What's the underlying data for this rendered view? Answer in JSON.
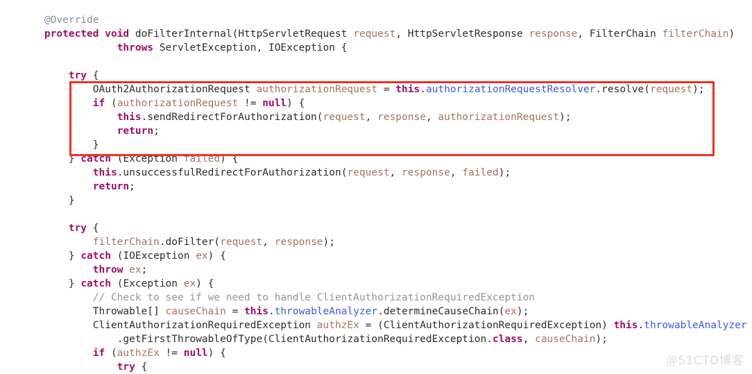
{
  "editor": {
    "language": "java",
    "background_color": "#ffffff",
    "colors": {
      "annotation": "#808fa0",
      "keyword": "#9a0f6a",
      "plain": "#2b2b2b",
      "parameter": "#a0755f",
      "local_variable": "#a0755f",
      "field": "#3b5bd4",
      "comment": "#8c9a8c",
      "highlight_border": "#ef3124",
      "watermark": "#dcdcdc"
    },
    "lines": [
      {
        "indent": 1,
        "tokens": [
          {
            "t": "annotation",
            "v": "@Override"
          }
        ]
      },
      {
        "indent": 1,
        "tokens": [
          {
            "t": "keyword",
            "v": "protected"
          },
          {
            "t": "plain",
            "v": " "
          },
          {
            "t": "keyword",
            "v": "void"
          },
          {
            "t": "plain",
            "v": " "
          },
          {
            "t": "method",
            "v": "doFilterInternal"
          },
          {
            "t": "plain",
            "v": "("
          },
          {
            "t": "type",
            "v": "HttpServletRequest"
          },
          {
            "t": "plain",
            "v": " "
          },
          {
            "t": "param",
            "v": "request"
          },
          {
            "t": "plain",
            "v": ", "
          },
          {
            "t": "type",
            "v": "HttpServletResponse"
          },
          {
            "t": "plain",
            "v": " "
          },
          {
            "t": "param",
            "v": "response"
          },
          {
            "t": "plain",
            "v": ", "
          },
          {
            "t": "type",
            "v": "FilterChain"
          },
          {
            "t": "plain",
            "v": " "
          },
          {
            "t": "param",
            "v": "filterChain"
          },
          {
            "t": "plain",
            "v": ")"
          }
        ]
      },
      {
        "indent": 4,
        "tokens": [
          {
            "t": "keyword",
            "v": "throws"
          },
          {
            "t": "plain",
            "v": " "
          },
          {
            "t": "type",
            "v": "ServletException"
          },
          {
            "t": "plain",
            "v": ", "
          },
          {
            "t": "type",
            "v": "IOException"
          },
          {
            "t": "plain",
            "v": " {"
          }
        ]
      },
      {
        "indent": 0,
        "tokens": []
      },
      {
        "indent": 2,
        "tokens": [
          {
            "t": "keyword",
            "v": "try"
          },
          {
            "t": "plain",
            "v": " {"
          }
        ]
      },
      {
        "indent": 3,
        "tokens": [
          {
            "t": "type",
            "v": "OAuth2AuthorizationRequest"
          },
          {
            "t": "plain",
            "v": " "
          },
          {
            "t": "local",
            "v": "authorizationRequest"
          },
          {
            "t": "plain",
            "v": " = "
          },
          {
            "t": "keyword",
            "v": "this"
          },
          {
            "t": "plain",
            "v": "."
          },
          {
            "t": "field",
            "v": "authorizationRequestResolver"
          },
          {
            "t": "plain",
            "v": "."
          },
          {
            "t": "method",
            "v": "resolve"
          },
          {
            "t": "plain",
            "v": "("
          },
          {
            "t": "param",
            "v": "request"
          },
          {
            "t": "plain",
            "v": ");"
          }
        ]
      },
      {
        "indent": 3,
        "tokens": [
          {
            "t": "keyword",
            "v": "if"
          },
          {
            "t": "plain",
            "v": " ("
          },
          {
            "t": "local",
            "v": "authorizationRequest"
          },
          {
            "t": "plain",
            "v": " != "
          },
          {
            "t": "keyword",
            "v": "null"
          },
          {
            "t": "plain",
            "v": ") {"
          }
        ]
      },
      {
        "indent": 4,
        "tokens": [
          {
            "t": "keyword",
            "v": "this"
          },
          {
            "t": "plain",
            "v": "."
          },
          {
            "t": "method",
            "v": "sendRedirectForAuthorization"
          },
          {
            "t": "plain",
            "v": "("
          },
          {
            "t": "param",
            "v": "request"
          },
          {
            "t": "plain",
            "v": ", "
          },
          {
            "t": "param",
            "v": "response"
          },
          {
            "t": "plain",
            "v": ", "
          },
          {
            "t": "local",
            "v": "authorizationRequest"
          },
          {
            "t": "plain",
            "v": ");"
          }
        ]
      },
      {
        "indent": 4,
        "tokens": [
          {
            "t": "keyword",
            "v": "return"
          },
          {
            "t": "plain",
            "v": ";"
          }
        ]
      },
      {
        "indent": 3,
        "tokens": [
          {
            "t": "plain",
            "v": "}"
          }
        ]
      },
      {
        "indent": 2,
        "tokens": [
          {
            "t": "plain",
            "v": "} "
          },
          {
            "t": "keyword",
            "v": "catch"
          },
          {
            "t": "plain",
            "v": " ("
          },
          {
            "t": "type",
            "v": "Exception"
          },
          {
            "t": "plain",
            "v": " "
          },
          {
            "t": "param",
            "v": "failed"
          },
          {
            "t": "plain",
            "v": ") {"
          }
        ]
      },
      {
        "indent": 3,
        "tokens": [
          {
            "t": "keyword",
            "v": "this"
          },
          {
            "t": "plain",
            "v": "."
          },
          {
            "t": "method",
            "v": "unsuccessfulRedirectForAuthorization"
          },
          {
            "t": "plain",
            "v": "("
          },
          {
            "t": "param",
            "v": "request"
          },
          {
            "t": "plain",
            "v": ", "
          },
          {
            "t": "param",
            "v": "response"
          },
          {
            "t": "plain",
            "v": ", "
          },
          {
            "t": "param",
            "v": "failed"
          },
          {
            "t": "plain",
            "v": ");"
          }
        ]
      },
      {
        "indent": 3,
        "tokens": [
          {
            "t": "keyword",
            "v": "return"
          },
          {
            "t": "plain",
            "v": ";"
          }
        ]
      },
      {
        "indent": 2,
        "tokens": [
          {
            "t": "plain",
            "v": "}"
          }
        ]
      },
      {
        "indent": 0,
        "tokens": []
      },
      {
        "indent": 2,
        "tokens": [
          {
            "t": "keyword",
            "v": "try"
          },
          {
            "t": "plain",
            "v": " {"
          }
        ]
      },
      {
        "indent": 3,
        "tokens": [
          {
            "t": "param",
            "v": "filterChain"
          },
          {
            "t": "plain",
            "v": "."
          },
          {
            "t": "method",
            "v": "doFilter"
          },
          {
            "t": "plain",
            "v": "("
          },
          {
            "t": "param",
            "v": "request"
          },
          {
            "t": "plain",
            "v": ", "
          },
          {
            "t": "param",
            "v": "response"
          },
          {
            "t": "plain",
            "v": ");"
          }
        ]
      },
      {
        "indent": 2,
        "tokens": [
          {
            "t": "plain",
            "v": "} "
          },
          {
            "t": "keyword",
            "v": "catch"
          },
          {
            "t": "plain",
            "v": " ("
          },
          {
            "t": "type",
            "v": "IOException"
          },
          {
            "t": "plain",
            "v": " "
          },
          {
            "t": "param",
            "v": "ex"
          },
          {
            "t": "plain",
            "v": ") {"
          }
        ]
      },
      {
        "indent": 3,
        "tokens": [
          {
            "t": "keyword",
            "v": "throw"
          },
          {
            "t": "plain",
            "v": " "
          },
          {
            "t": "param",
            "v": "ex"
          },
          {
            "t": "plain",
            "v": ";"
          }
        ]
      },
      {
        "indent": 2,
        "tokens": [
          {
            "t": "plain",
            "v": "} "
          },
          {
            "t": "keyword",
            "v": "catch"
          },
          {
            "t": "plain",
            "v": " ("
          },
          {
            "t": "type",
            "v": "Exception"
          },
          {
            "t": "plain",
            "v": " "
          },
          {
            "t": "param",
            "v": "ex"
          },
          {
            "t": "plain",
            "v": ") {"
          }
        ]
      },
      {
        "indent": 3,
        "tokens": [
          {
            "t": "comment",
            "v": "// Check to see if we need to handle ClientAuthorizationRequiredException"
          }
        ]
      },
      {
        "indent": 3,
        "tokens": [
          {
            "t": "type",
            "v": "Throwable[]"
          },
          {
            "t": "plain",
            "v": " "
          },
          {
            "t": "local",
            "v": "causeChain"
          },
          {
            "t": "plain",
            "v": " = "
          },
          {
            "t": "keyword",
            "v": "this"
          },
          {
            "t": "plain",
            "v": "."
          },
          {
            "t": "field",
            "v": "throwableAnalyzer"
          },
          {
            "t": "plain",
            "v": "."
          },
          {
            "t": "method",
            "v": "determineCauseChain"
          },
          {
            "t": "plain",
            "v": "("
          },
          {
            "t": "param",
            "v": "ex"
          },
          {
            "t": "plain",
            "v": ");"
          }
        ]
      },
      {
        "indent": 3,
        "tokens": [
          {
            "t": "type",
            "v": "ClientAuthorizationRequiredException"
          },
          {
            "t": "plain",
            "v": " "
          },
          {
            "t": "local",
            "v": "authzEx"
          },
          {
            "t": "plain",
            "v": " = ("
          },
          {
            "t": "type",
            "v": "ClientAuthorizationRequiredException"
          },
          {
            "t": "plain",
            "v": ") "
          },
          {
            "t": "keyword",
            "v": "this"
          },
          {
            "t": "plain",
            "v": "."
          },
          {
            "t": "field",
            "v": "throwableAnalyzer"
          }
        ]
      },
      {
        "indent": 4,
        "tokens": [
          {
            "t": "plain",
            "v": "."
          },
          {
            "t": "method",
            "v": "getFirstThrowableOfType"
          },
          {
            "t": "plain",
            "v": "("
          },
          {
            "t": "type",
            "v": "ClientAuthorizationRequiredException"
          },
          {
            "t": "plain",
            "v": "."
          },
          {
            "t": "keyword",
            "v": "class"
          },
          {
            "t": "plain",
            "v": ", "
          },
          {
            "t": "local",
            "v": "causeChain"
          },
          {
            "t": "plain",
            "v": ");"
          }
        ]
      },
      {
        "indent": 3,
        "tokens": [
          {
            "t": "keyword",
            "v": "if"
          },
          {
            "t": "plain",
            "v": " ("
          },
          {
            "t": "local",
            "v": "authzEx"
          },
          {
            "t": "plain",
            "v": " != "
          },
          {
            "t": "keyword",
            "v": "null"
          },
          {
            "t": "plain",
            "v": ") {"
          }
        ]
      },
      {
        "indent": 4,
        "tokens": [
          {
            "t": "keyword",
            "v": "try"
          },
          {
            "t": "plain",
            "v": " {"
          }
        ]
      }
    ]
  },
  "highlight": {
    "label": "code-highlight-rectangle",
    "border_color": "#ef3124"
  },
  "watermark": {
    "text": "@51CTO博客"
  }
}
